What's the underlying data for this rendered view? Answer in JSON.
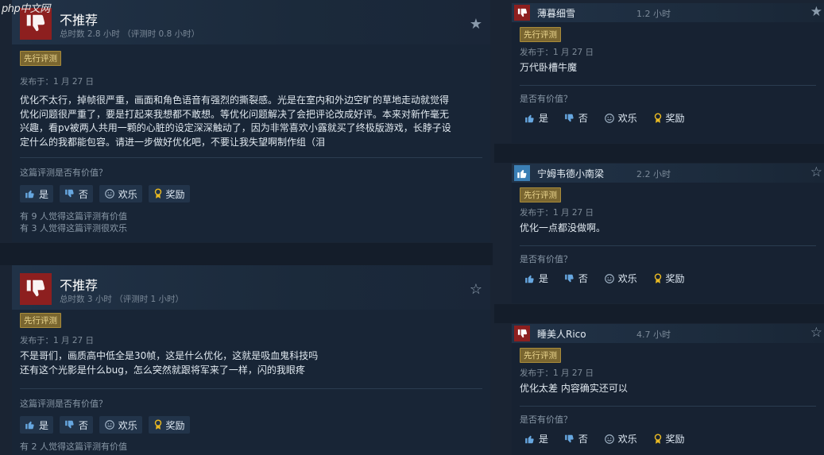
{
  "watermark": "php中文网",
  "colors": {
    "background": "#1b2838",
    "card": "#182536",
    "thumbs_down": "#8d1f1f",
    "thumbs_up": "#3b7fb5",
    "early_access_badge": "#7a6630"
  },
  "left_reviews": [
    {
      "verdict": "不推荐",
      "hours": "总时数 2.8 小时 （评测时 0.8 小时）",
      "badge": "先行评测",
      "posted": "发布于：1 月 27 日",
      "body_lines": [
        "优化不太行，掉帧很严重，画面和角色语音有强烈的撕裂感。光是在室内和外边空旷的草地走动就觉得",
        "优化问题很严重了，要是打起来我想都不敢想。等优化问题解决了会把评论改成好评。本来对新作毫无",
        "兴趣，看pv被两人共用一颗的心脏的设定深深触动了，因为非常喜欢小露就买了终极版游戏，长脖子设",
        "定什么的我都能包容。请进一步做好优化吧，不要让我失望啊制作组（泪"
      ],
      "helpful_question": "这篇评测是否有价值？",
      "buttons": {
        "yes": "是",
        "no": "否",
        "funny": "欢乐",
        "award": "奖励"
      },
      "counts": [
        "有 9 人觉得这篇评测有价值",
        "有 3 人觉得这篇评测很欢乐"
      ]
    },
    {
      "verdict": "不推荐",
      "hours": "总时数 3 小时 （评测时 1 小时）",
      "badge": "先行评测",
      "posted": "发布于：1 月 27 日",
      "body_lines": [
        "不是哥们，画质高中低全是30帧，这是什么优化，这就是吸血鬼科技吗",
        "还有这个光影是什么bug，怎么突然就跟将军来了一样，闪的我眼疼"
      ],
      "helpful_question": "这篇评测是否有价值？",
      "buttons": {
        "yes": "是",
        "no": "否",
        "funny": "欢乐",
        "award": "奖励"
      },
      "counts": [
        "有 2 人觉得这篇评测有价值"
      ]
    }
  ],
  "right_reviews": [
    {
      "name": "薄暮细雪",
      "hours": "1.2 小时",
      "recommended": false,
      "badge": "先行评测",
      "posted": "发布于：1 月 27 日",
      "body": "万代卧槽牛魔",
      "helpful_question": "是否有价值？",
      "buttons": {
        "yes": "是",
        "no": "否",
        "funny": "欢乐",
        "award": "奖励"
      }
    },
    {
      "name": "宁姆韦德小南梁",
      "hours": "2.2 小时",
      "recommended": true,
      "badge": "先行评测",
      "posted": "发布于：1 月 27 日",
      "body": "优化一点都没做啊。",
      "helpful_question": "是否有价值？",
      "buttons": {
        "yes": "是",
        "no": "否",
        "funny": "欢乐",
        "award": "奖励"
      }
    },
    {
      "name": "睡美人Rico",
      "hours": "4.7 小时",
      "recommended": false,
      "badge": "先行评测",
      "posted": "发布于：1 月 27 日",
      "body": "优化太差 内容确实还可以",
      "helpful_question": "是否有价值？",
      "buttons": {
        "yes": "是",
        "no": "否",
        "funny": "欢乐",
        "award": "奖励"
      }
    }
  ]
}
